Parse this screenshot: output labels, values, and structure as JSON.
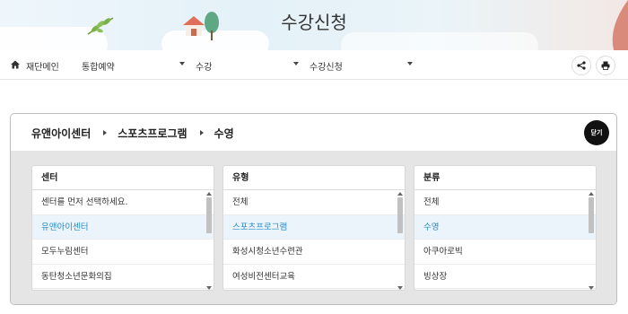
{
  "header": {
    "title": "수강신청"
  },
  "breadcrumb": {
    "home_label": "재단메인",
    "level1": "통합예약",
    "level2": "수강",
    "level3": "수강신청"
  },
  "modal": {
    "path": [
      "유앤아이센터",
      "스포츠프로그램",
      "수영"
    ],
    "close_label": "닫기",
    "columns": [
      {
        "header": "센터",
        "items": [
          "센터를 먼저 선택하세요.",
          "유앤아이센터",
          "모두누림센터",
          "동탄청소년문화의집"
        ],
        "selected": 1
      },
      {
        "header": "유형",
        "items": [
          "전체",
          "스포츠프로그램",
          "화성시청소년수련관",
          "여성비전센터교육"
        ],
        "selected": 1
      },
      {
        "header": "분류",
        "items": [
          "전체",
          "수영",
          "아쿠아로빅",
          "빙상장"
        ],
        "selected": 1
      }
    ]
  },
  "colors": {
    "selected_text": "#2a8bc7",
    "selected_bg": "#ebf4fb"
  },
  "icons": [
    "home-icon",
    "share-icon",
    "print-icon",
    "chevron-right-icon",
    "caret-down-icon"
  ]
}
